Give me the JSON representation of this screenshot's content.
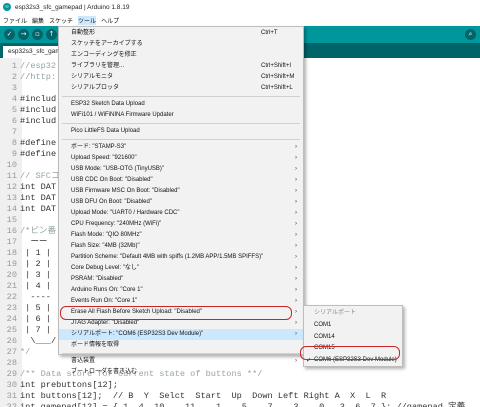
{
  "window": {
    "title": "esp32s3_sfc_gamepad | Arduino 1.8.19"
  },
  "menubar": [
    "ファイル",
    "編集",
    "スケッチ",
    "ツール",
    "ヘルプ"
  ],
  "toolbar": {
    "icons": [
      "verify-icon",
      "upload-icon",
      "new-icon",
      "open-icon",
      "save-icon",
      "serial-monitor-icon"
    ]
  },
  "tab": {
    "label": "esp32s3_sfc_gam"
  },
  "code_lines": [
    {
      "n": "1",
      "text": "//esp32"
    },
    {
      "n": "2",
      "text": "//http:"
    },
    {
      "n": "3",
      "text": ""
    },
    {
      "n": "4",
      "text": "#includ"
    },
    {
      "n": "5",
      "text": "#includ"
    },
    {
      "n": "6",
      "text": "#includ"
    },
    {
      "n": "7",
      "text": ""
    },
    {
      "n": "8",
      "text": "#define"
    },
    {
      "n": "9",
      "text": "#define"
    },
    {
      "n": "10",
      "text": ""
    },
    {
      "n": "11",
      "text": "// SFCコ"
    },
    {
      "n": "12",
      "text": "int DAT"
    },
    {
      "n": "13",
      "text": "int DAT"
    },
    {
      "n": "14",
      "text": "int DAT"
    },
    {
      "n": "15",
      "text": ""
    },
    {
      "n": "16",
      "text": "/*ピン番"
    },
    {
      "n": "17",
      "text": "  ーー"
    },
    {
      "n": "18",
      "text": " | 1 |"
    },
    {
      "n": "19",
      "text": " | 2 |"
    },
    {
      "n": "20",
      "text": " | 3 |"
    },
    {
      "n": "21",
      "text": " | 4 |"
    },
    {
      "n": "22",
      "text": "  ----"
    },
    {
      "n": "23",
      "text": " | 5 |"
    },
    {
      "n": "24",
      "text": " | 6 |"
    },
    {
      "n": "25",
      "text": " | 7 |"
    },
    {
      "n": "26",
      "text": "  \\___/"
    },
    {
      "n": "27",
      "text": "*/"
    },
    {
      "n": "28",
      "text": ""
    },
    {
      "n": "29",
      "text": "/** Data store for current state of buttons **/"
    },
    {
      "n": "30",
      "text": "int prebuttons[12];"
    },
    {
      "n": "31",
      "text": "int buttons[12];  // B  Y  Selct  Start  Up  Down Left Right A  X  L  R"
    },
    {
      "n": "32",
      "text": "int gamepad[12] = { 1  4  10    11    1    5    7    3    0   3  6  7 }; //gamepad 定義"
    }
  ],
  "tools_menu": {
    "items": [
      {
        "label": "自動整形",
        "shortcut": "Ctrl+T",
        "arrow": false
      },
      {
        "label": "スケッチをアーカイブする",
        "shortcut": "",
        "arrow": false
      },
      {
        "label": "エンコーディングを修正",
        "shortcut": "",
        "arrow": false
      },
      {
        "label": "ライブラリを管理...",
        "shortcut": "Ctrl+Shift+I",
        "arrow": false
      },
      {
        "label": "シリアルモニタ",
        "shortcut": "Ctrl+Shift+M",
        "arrow": false
      },
      {
        "label": "シリアルプロッタ",
        "shortcut": "Ctrl+Shift+L",
        "arrow": false
      },
      {
        "sep": true
      },
      {
        "label": "ESP32 Sketch Data Upload",
        "shortcut": "",
        "arrow": false
      },
      {
        "label": "WiFi101 / WiFiNINA Firmware Updater",
        "shortcut": "",
        "arrow": false
      },
      {
        "sep": true
      },
      {
        "label": "Pico LittleFS Data Upload",
        "shortcut": "",
        "arrow": false
      },
      {
        "sep": true
      },
      {
        "label": "ボード: \"STAMP-S3\"",
        "shortcut": "",
        "arrow": true
      },
      {
        "label": "Upload Speed: \"921600\"",
        "shortcut": "",
        "arrow": true
      },
      {
        "label": "USB Mode: \"USB-OTG (TinyUSB)\"",
        "shortcut": "",
        "arrow": true
      },
      {
        "label": "USB CDC On Boot: \"Disabled\"",
        "shortcut": "",
        "arrow": true
      },
      {
        "label": "USB Firmware MSC On Boot: \"Disabled\"",
        "shortcut": "",
        "arrow": true
      },
      {
        "label": "USB DFU On Boot: \"Disabled\"",
        "shortcut": "",
        "arrow": true
      },
      {
        "label": "Upload Mode: \"UART0 / Hardware CDC\"",
        "shortcut": "",
        "arrow": true
      },
      {
        "label": "CPU Frequency: \"240MHz (WiFi)\"",
        "shortcut": "",
        "arrow": true
      },
      {
        "label": "Flash Mode: \"QIO 80MHz\"",
        "shortcut": "",
        "arrow": true
      },
      {
        "label": "Flash Size: \"4MB (32Mb)\"",
        "shortcut": "",
        "arrow": true
      },
      {
        "label": "Partition Scheme: \"Default 4MB with spiffs (1.2MB APP/1.5MB SPIFFS)\"",
        "shortcut": "",
        "arrow": true
      },
      {
        "label": "Core Debug Level: \"なし\"",
        "shortcut": "",
        "arrow": true
      },
      {
        "label": "PSRAM: \"Disabled\"",
        "shortcut": "",
        "arrow": true
      },
      {
        "label": "Arduino Runs On: \"Core 1\"",
        "shortcut": "",
        "arrow": true
      },
      {
        "label": "Events Run On: \"Core 1\"",
        "shortcut": "",
        "arrow": true
      },
      {
        "label": "Erase All Flash Before Sketch Upload: \"Disabled\"",
        "shortcut": "",
        "arrow": true
      },
      {
        "label": "JTAG Adapter: \"Disabled\"",
        "shortcut": "",
        "arrow": true
      },
      {
        "label": "シリアルポート: \"COM6 (ESP32S3 Dev Module)\"",
        "shortcut": "",
        "arrow": true,
        "highlighted": true
      },
      {
        "label": "ボード情報を取得",
        "shortcut": "",
        "arrow": false
      },
      {
        "sep": true
      },
      {
        "label": "書込装置",
        "shortcut": "",
        "arrow": true
      },
      {
        "label": "ブートローダを書き込む",
        "shortcut": "",
        "arrow": false
      }
    ]
  },
  "port_menu": {
    "header": "シリアルポート",
    "items": [
      {
        "label": "COM1",
        "checked": false
      },
      {
        "label": "COM14",
        "checked": false
      },
      {
        "label": "COM15",
        "checked": false
      },
      {
        "label": "COM6 (ESP32S3 Dev Module)",
        "checked": true
      }
    ]
  },
  "colors": {
    "arduino_teal": "#00979c",
    "arduino_dark_teal": "#006468",
    "annotation_red": "#c62828",
    "menu_highlight": "#cce8ff"
  }
}
